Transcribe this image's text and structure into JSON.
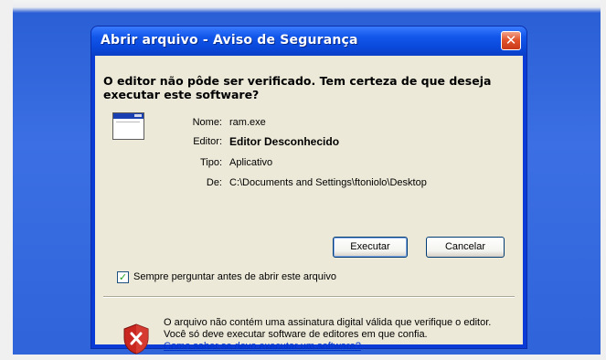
{
  "window": {
    "title": "Abrir arquivo - Aviso de Segurança",
    "close_glyph": "✕"
  },
  "dialog": {
    "headline": "O editor não pôde ser verificado.  Tem certeza de que deseja executar este software?",
    "icon": "application-window-icon",
    "fields": {
      "name_label": "Nome:",
      "name_value": "ram.exe",
      "publisher_label": "Editor:",
      "publisher_value": "Editor Desconhecido",
      "type_label": "Tipo:",
      "type_value": "Aplicativo",
      "from_label": "De:",
      "from_value": "C:\\Documents and Settings\\ftoniolo\\Desktop"
    },
    "buttons": {
      "run_label": "Executar",
      "cancel_label": "Cancelar"
    },
    "checkbox": {
      "label": "Sempre perguntar antes de abrir este arquivo",
      "checked": true,
      "glyph": "✓"
    },
    "warning": {
      "icon": "shield-error-icon",
      "text": "O arquivo não contém uma assinatura digital válida que verifique o editor.  Você só deve executar software de editores em que confia.",
      "link": "Como saber se devo executar um software?"
    }
  },
  "colors": {
    "titlebar": "#0a49dc",
    "dialog_bg": "#ece9d8",
    "close_button": "#e2542c",
    "link": "#0033cc",
    "shield_red": "#c8261f"
  }
}
